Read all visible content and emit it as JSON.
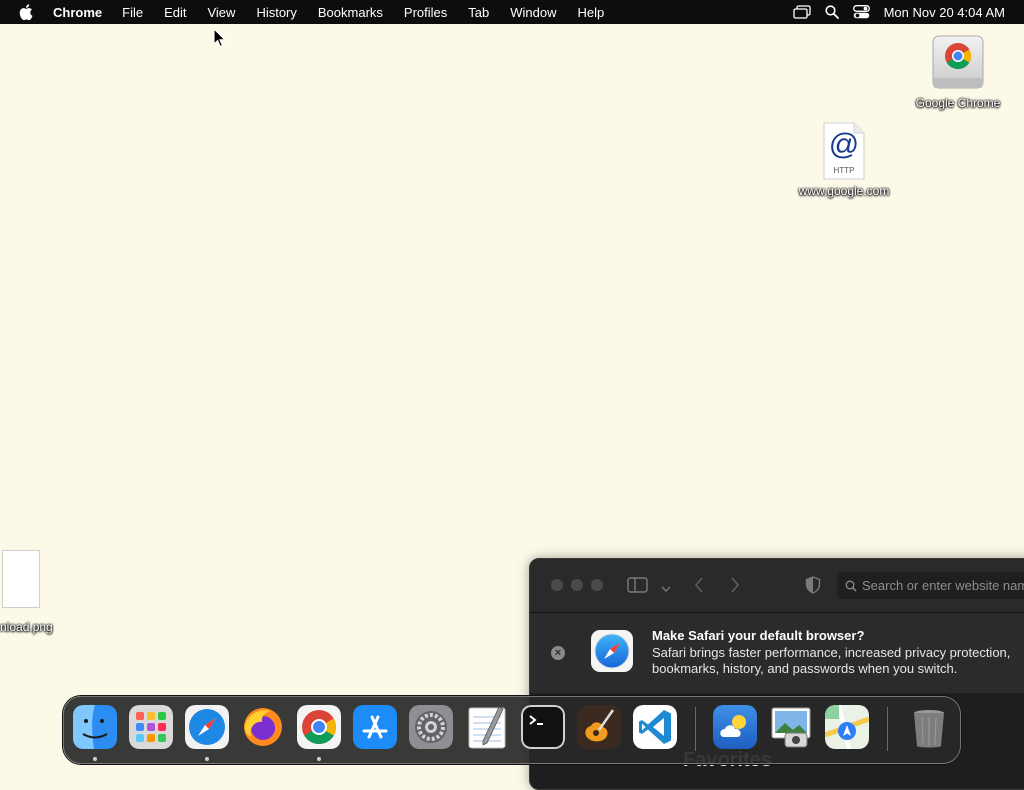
{
  "menubar": {
    "apple_icon": "apple-logo-icon",
    "app_name": "Chrome",
    "items": [
      "File",
      "Edit",
      "View",
      "History",
      "Bookmarks",
      "Profiles",
      "Tab",
      "Window",
      "Help"
    ],
    "status_icons": [
      "screen-mirroring-icon",
      "spotlight-search-icon",
      "control-center-icon"
    ],
    "clock": "Mon Nov 20  4:04 AM"
  },
  "desktop": {
    "icons": [
      {
        "label": "Google Chrome",
        "icon": "chrome-drive-icon"
      },
      {
        "label": "www.google.com",
        "icon": "http-location-icon",
        "glyph": "@",
        "sub": "HTTP"
      },
      {
        "label": "nload.png",
        "icon": "png-file-icon"
      }
    ]
  },
  "safari": {
    "address_placeholder": "Search or enter website name",
    "banner": {
      "title": "Make Safari your default browser?",
      "line1": "Safari brings faster performance, increased privacy protection,",
      "line2": "bookmarks, history, and passwords when you switch."
    },
    "favorites_heading": "Favorites"
  },
  "dock": {
    "apps": [
      "Finder",
      "Launchpad",
      "Safari",
      "Firefox",
      "Google Chrome",
      "App Store",
      "System Settings",
      "TextEdit",
      "Terminal",
      "GarageBand",
      "Visual Studio Code",
      "Weather",
      "Preview",
      "Maps",
      "Trash"
    ]
  },
  "colors": {
    "desktop": "#fcf9e8",
    "menubar": "#0d0d0d",
    "safari_bg": "#1e1e1e",
    "accent_blue": "#1e88e5"
  }
}
